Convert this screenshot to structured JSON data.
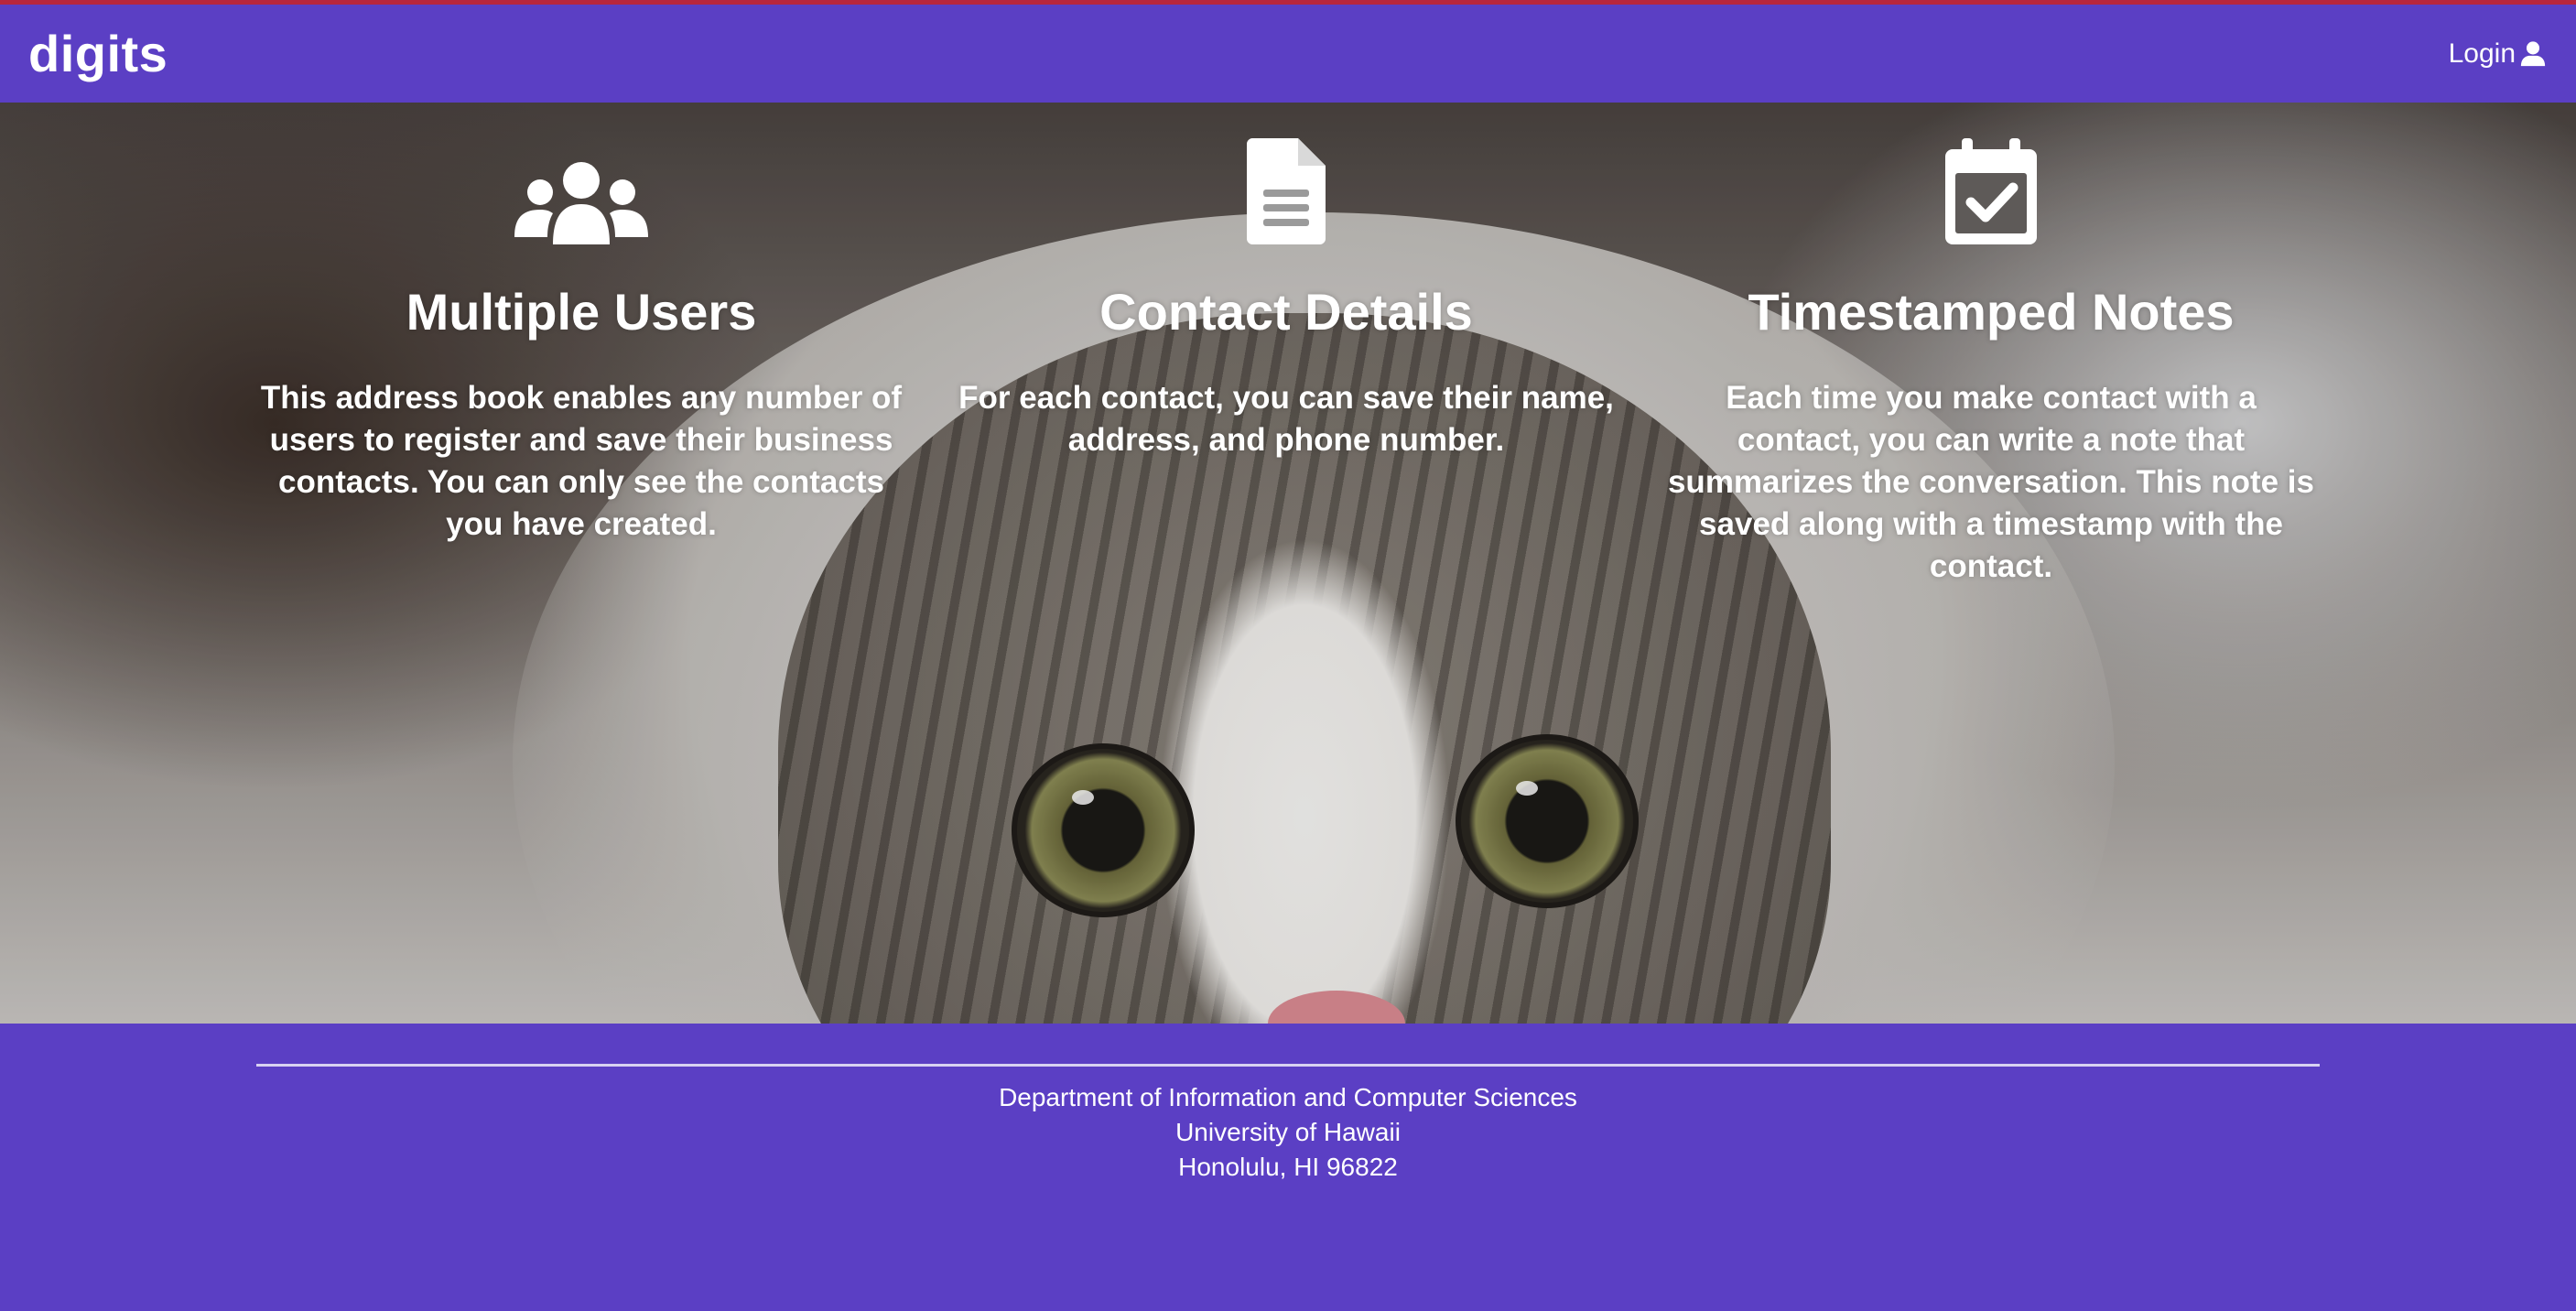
{
  "navbar": {
    "brand": "digits",
    "login_label": "Login",
    "login_icon": "user-icon"
  },
  "features": [
    {
      "icon": "users-icon",
      "title": "Multiple Users",
      "text": "This address book enables any number of users to register and save their business contacts. You can only see the contacts you have created."
    },
    {
      "icon": "file-text-icon",
      "title": "Contact Details",
      "text": "For each contact, you can save their name, address, and phone number."
    },
    {
      "icon": "calendar-check-icon",
      "title": "Timestamped Notes",
      "text": "Each time you make contact with a contact, you can write a note that summarizes the conversation. This note is saved along with a timestamp with the contact."
    }
  ],
  "footer": {
    "line1": "Department of Information and Computer Sciences",
    "line2": "University of Hawaii",
    "line3": "Honolulu, HI 96822"
  },
  "colors": {
    "brand": "#5b3fc4",
    "top_accent": "#b8263d",
    "text": "#ffffff"
  }
}
